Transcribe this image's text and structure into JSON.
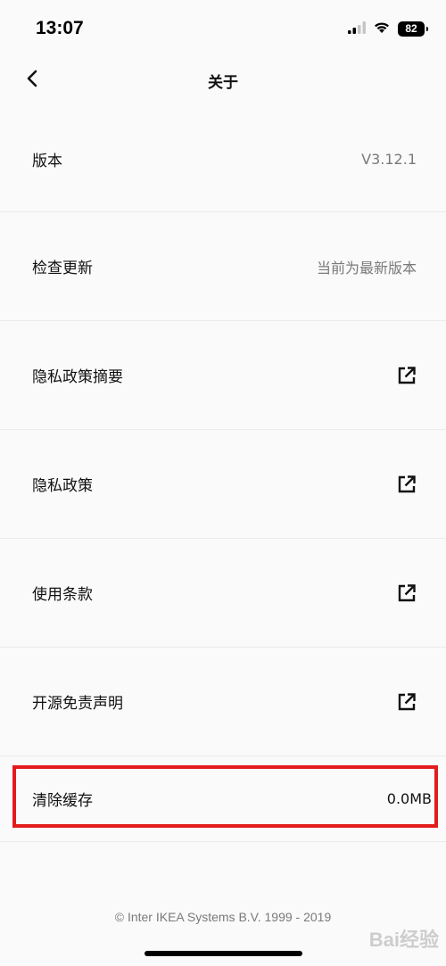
{
  "status_bar": {
    "time": "13:07",
    "battery": "82",
    "icons": [
      "signal-icon",
      "wifi-icon",
      "battery-icon"
    ]
  },
  "nav": {
    "title": "关于",
    "back_icon": "chevron-left-icon"
  },
  "rows": {
    "version": {
      "label": "版本",
      "value": "V3.12.1"
    },
    "check_update": {
      "label": "检查更新",
      "value": "当前为最新版本"
    },
    "privacy_summary": {
      "label": "隐私政策摘要",
      "icon": "external-link-icon"
    },
    "privacy_policy": {
      "label": "隐私政策",
      "icon": "external-link-icon"
    },
    "terms": {
      "label": "使用条款",
      "icon": "external-link-icon"
    },
    "open_source": {
      "label": "开源免责声明",
      "icon": "external-link-icon"
    },
    "clear_cache": {
      "label": "清除缓存",
      "value": "0.0MB"
    }
  },
  "footer": {
    "copyright": "© Inter IKEA Systems B.V. 1999 - 2019"
  },
  "watermark": {
    "text": "Bai经验"
  },
  "colors": {
    "highlight": "#e31b1b",
    "secondary_text": "#7a7a7a",
    "background": "#fafafa"
  }
}
